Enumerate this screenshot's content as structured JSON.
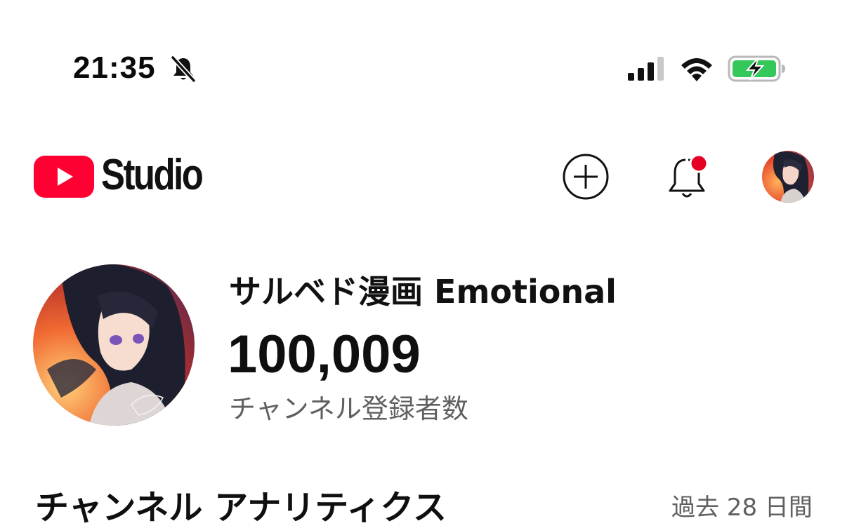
{
  "status_bar": {
    "time": "21:35",
    "icons": [
      "bell-slash-icon",
      "cellular-signal-icon",
      "wifi-icon",
      "battery-charging-icon"
    ],
    "battery_color": "#34c759"
  },
  "header": {
    "logo_text": "Studio",
    "brand_color": "#ff0033",
    "icons": [
      "youtube-logo-icon",
      "create-plus-icon",
      "notification-bell-icon",
      "account-avatar"
    ],
    "notification_dot_color": "#e60023"
  },
  "channel": {
    "name": "サルベド漫画 Emotional",
    "subscriber_count": "100,009",
    "subscriber_label": "チャンネル登録者数"
  },
  "analytics": {
    "title": "チャンネル アナリティクス",
    "period": "過去 28 日間"
  }
}
